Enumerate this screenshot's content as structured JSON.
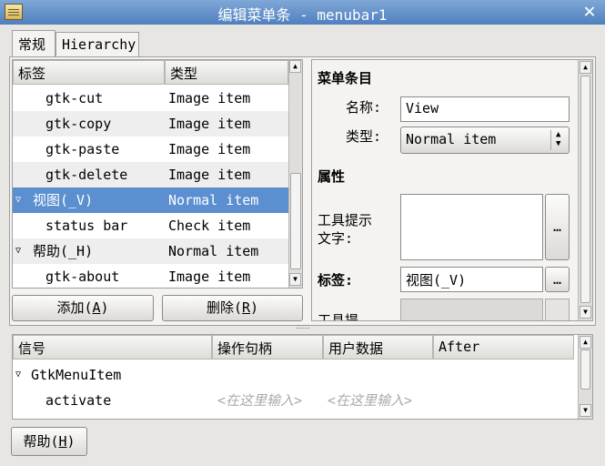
{
  "window": {
    "title": "编辑菜单条 - menubar1",
    "close_glyph": "✕"
  },
  "tabs": [
    {
      "label": "常规"
    },
    {
      "label": "Hierarchy"
    }
  ],
  "tree": {
    "columns": [
      "标签",
      "类型"
    ],
    "rows": [
      {
        "label": "gtk-cut",
        "type": "Image item",
        "expander": ""
      },
      {
        "label": "gtk-copy",
        "type": "Image item",
        "expander": ""
      },
      {
        "label": "gtk-paste",
        "type": "Image item",
        "expander": ""
      },
      {
        "label": "gtk-delete",
        "type": "Image item",
        "expander": ""
      },
      {
        "label": "视图(_V)",
        "type": "Normal item",
        "expander": "▽"
      },
      {
        "label": "status bar",
        "type": "Check item",
        "expander": ""
      },
      {
        "label": "帮助(_H)",
        "type": "Normal item",
        "expander": "▽"
      },
      {
        "label": "gtk-about",
        "type": "Image item",
        "expander": ""
      }
    ]
  },
  "buttons": {
    "add": {
      "text": "添加(",
      "key": "A",
      "end": ")"
    },
    "remove": {
      "text": "删除(",
      "key": "R",
      "end": ")"
    },
    "help": {
      "text": "帮助(",
      "key": "H",
      "end": ")"
    }
  },
  "props": {
    "section_menu_item": "菜单条目",
    "name_label": "名称:",
    "name_value": "View",
    "type_label": "类型:",
    "type_value": "Normal item",
    "section_properties": "属性",
    "tooltip_label_1": "工具提示",
    "tooltip_label_2": "文字:",
    "ellipsis": "…",
    "tag_label": "标签:",
    "tag_value": "视图(_V)",
    "partial_label": "工具提"
  },
  "signals": {
    "columns": [
      "信号",
      "操作句柄",
      "用户数据",
      "After"
    ],
    "group": "GtkMenuItem",
    "group_expander": "▽",
    "signal": "activate",
    "handler_placeholder": "<在这里输入>",
    "data_placeholder": "<在这里输入>"
  }
}
